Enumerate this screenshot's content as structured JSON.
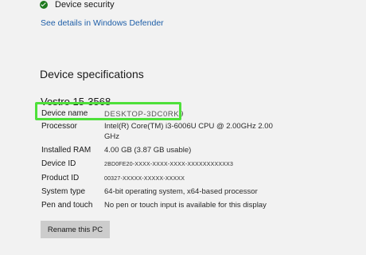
{
  "security": {
    "label": "Device security",
    "link": "See details in Windows Defender"
  },
  "specs": {
    "title": "Device specifications",
    "model": "Vostro 15-3568",
    "rows": [
      {
        "label": "Device name",
        "value": "DESKTOP-3DC0RK9"
      },
      {
        "label": "Processor",
        "value": "Intel(R) Core(TM) i3-6006U CPU @ 2.00GHz   2.00 GHz"
      },
      {
        "label": "Installed RAM",
        "value": "4.00 GB (3.87 GB usable)"
      },
      {
        "label": "Device ID",
        "value": "2BD0FE20-XXXX-XXXX-XXXX-XXXXXXXXXXX3"
      },
      {
        "label": "Product ID",
        "value": "00327-XXXXX-XXXXX-XXXXX"
      },
      {
        "label": "System type",
        "value": "64-bit operating system, x64-based processor"
      },
      {
        "label": "Pen and touch",
        "value": "No pen or touch input is available for this display"
      }
    ],
    "rename_button": "Rename this PC"
  },
  "colors": {
    "highlight": "#4ee03a",
    "link": "#1f5fa8",
    "check": "#1e7a1e"
  }
}
